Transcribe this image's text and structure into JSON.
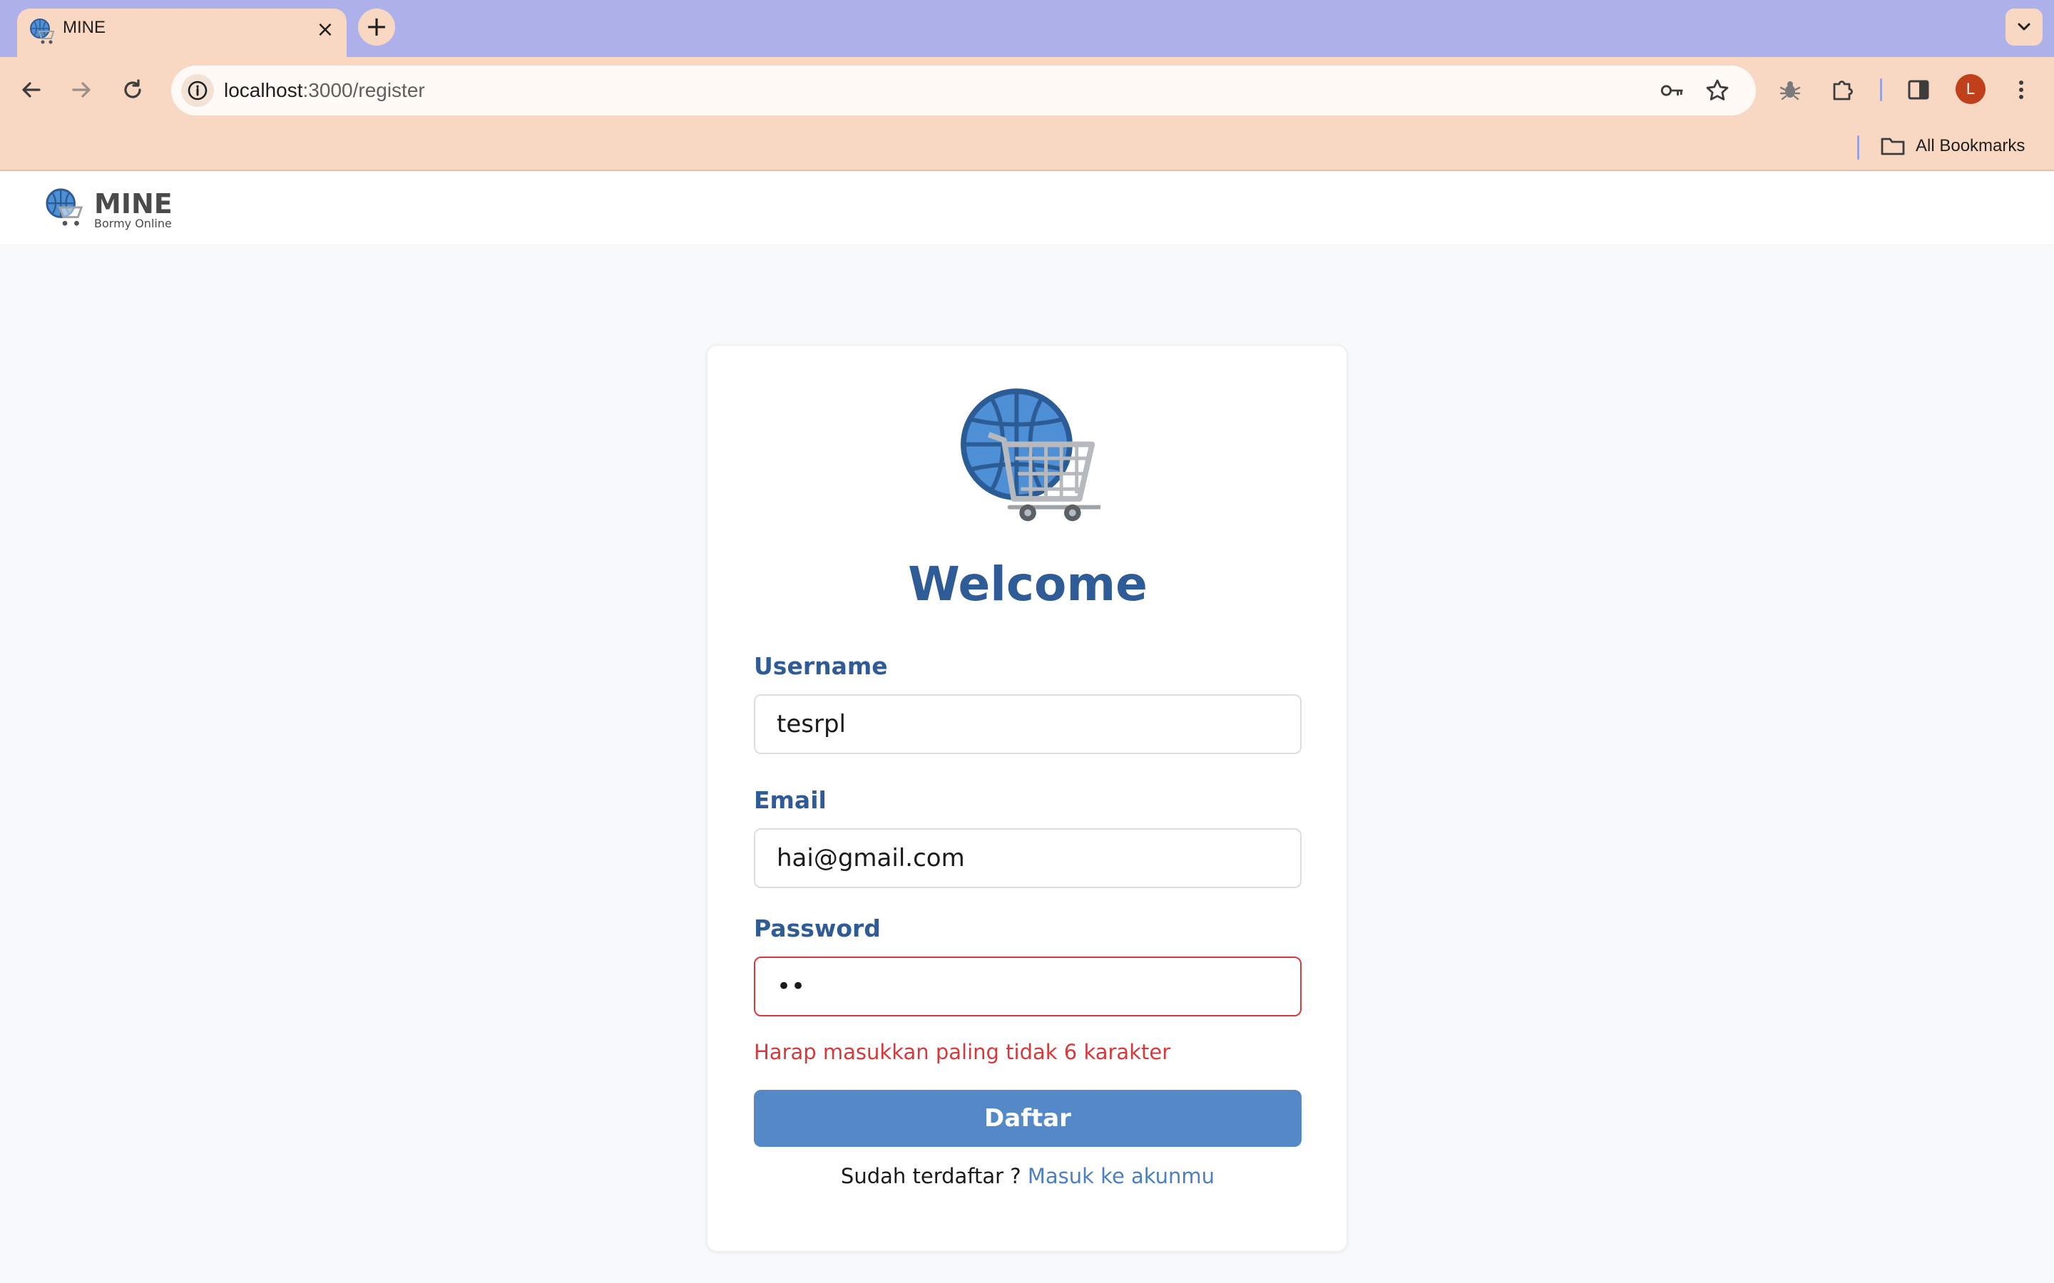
{
  "browser": {
    "tab": {
      "title": "MINE",
      "close_glyph": "×",
      "favicon": "globe-cart-icon"
    },
    "new_tab_glyph": "+",
    "url": {
      "host": "localhost",
      "path": ":3000/register"
    },
    "avatar_letter": "L",
    "bookmarks_label": "All Bookmarks",
    "icons": [
      "back-icon",
      "forward-icon",
      "reload-icon",
      "site-info-icon",
      "key-icon",
      "star-icon",
      "bug-icon",
      "extensions-icon",
      "side-panel-icon",
      "more-icon",
      "folder-icon"
    ]
  },
  "header": {
    "brand_name": "MINE",
    "brand_tagline": "Bormy Online"
  },
  "form": {
    "heading": "Welcome",
    "username": {
      "label": "Username",
      "value": "tesrpl"
    },
    "email": {
      "label": "Email",
      "value": "hai@gmail.com"
    },
    "password": {
      "label": "Password",
      "value": "••"
    },
    "error": "Harap masukkan paling tidak 6 karakter",
    "submit_label": "Daftar",
    "footer_text": "Sudah terdaftar ? ",
    "footer_link": "Masuk ke akunmu"
  },
  "colors": {
    "primary": "#2f5b96",
    "button": "#5588c6",
    "error": "#d53a3a",
    "link": "#4a7fc1"
  }
}
